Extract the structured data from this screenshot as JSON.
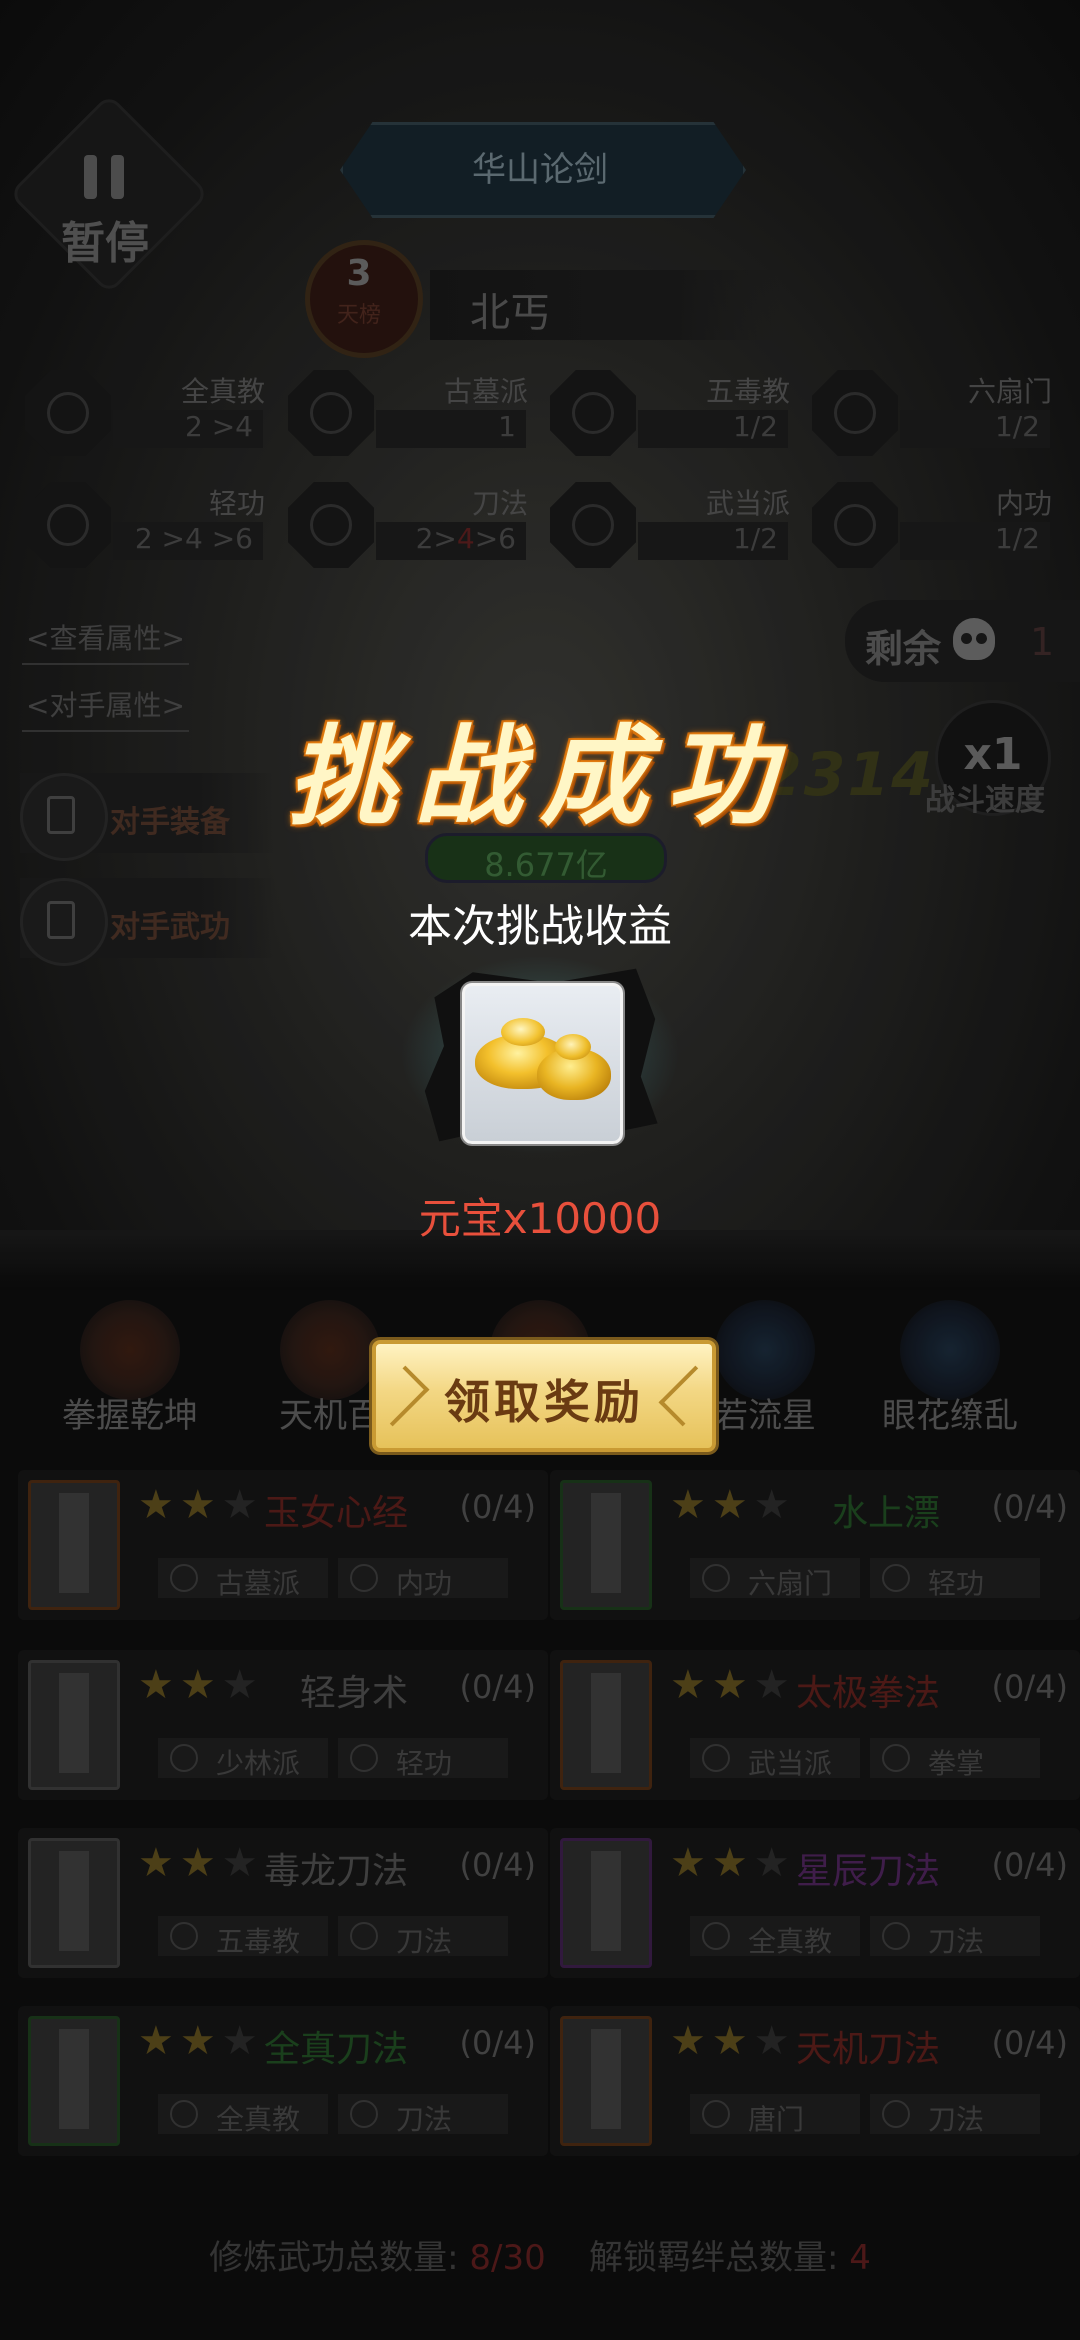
{
  "pause": {
    "label": "暂停"
  },
  "stage": {
    "title": "华山论剑"
  },
  "opponent": {
    "rank": "3",
    "rank_sub": "天榜",
    "name": "北丐"
  },
  "factions": [
    {
      "name": "全真教",
      "count": "2 >4"
    },
    {
      "name": "古墓派",
      "count": "1"
    },
    {
      "name": "五毒教",
      "count": "1/2"
    },
    {
      "name": "六扇门",
      "count": "1/2"
    },
    {
      "name": "轻功",
      "count": "2 >4 >6"
    },
    {
      "name": "刀法",
      "count_pre": "2>",
      "count_red": "4",
      "count_post": ">6"
    },
    {
      "name": "武当派",
      "count": "1/2"
    },
    {
      "name": "内功",
      "count": "1/2"
    }
  ],
  "links": {
    "view_attrs": "<查看属性>",
    "opp_attrs": "<对手属性>"
  },
  "side_buttons": {
    "equip": "对手装备",
    "skills": "对手武功"
  },
  "remaining": {
    "label": "剩余",
    "value": "1"
  },
  "speed": {
    "value": "x1",
    "label": "战斗速度"
  },
  "hp": {
    "value": "8.677亿"
  },
  "bg_number": "2314",
  "popup": {
    "title": "挑战成功",
    "subtitle": "本次挑战收益",
    "reward_text": "元宝x10000",
    "reward_icon": "gold-ingot-icon",
    "claim_button": "领取奖励"
  },
  "skills_row": [
    "拳握乾坤",
    "天机百",
    "",
    "若流星",
    "眼花缭乱"
  ],
  "kungfu": [
    {
      "name": "玉女心经",
      "progress": "(0/4)",
      "color": "#5a1e1a",
      "tags": [
        "古墓派",
        "内功"
      ]
    },
    {
      "name": "水上漂",
      "progress": "(0/4)",
      "color": "#1f4a22",
      "tags": [
        "六扇门",
        "轻功"
      ]
    },
    {
      "name": "轻身术",
      "progress": "(0/4)",
      "color": "#4a4a4a",
      "tags": [
        "少林派",
        "轻功"
      ]
    },
    {
      "name": "太极拳法",
      "progress": "(0/4)",
      "color": "#5a1e1a",
      "tags": [
        "武当派",
        "拳掌"
      ]
    },
    {
      "name": "毒龙刀法",
      "progress": "(0/4)",
      "color": "#4a4a4a",
      "tags": [
        "五毒教",
        "刀法"
      ]
    },
    {
      "name": "星辰刀法",
      "progress": "(0/4)",
      "color": "#4a2358",
      "tags": [
        "全真教",
        "刀法"
      ]
    },
    {
      "name": "全真刀法",
      "progress": "(0/4)",
      "color": "#1f4a22",
      "tags": [
        "全真教",
        "刀法"
      ]
    },
    {
      "name": "天机刀法",
      "progress": "(0/4)",
      "color": "#5a1e1a",
      "tags": [
        "唐门",
        "刀法"
      ]
    }
  ],
  "totals": {
    "trained_label": "修炼武功总数量:",
    "trained_value": "8/30",
    "bonds_label": "解锁羁绊总数量:",
    "bonds_value": "4"
  }
}
